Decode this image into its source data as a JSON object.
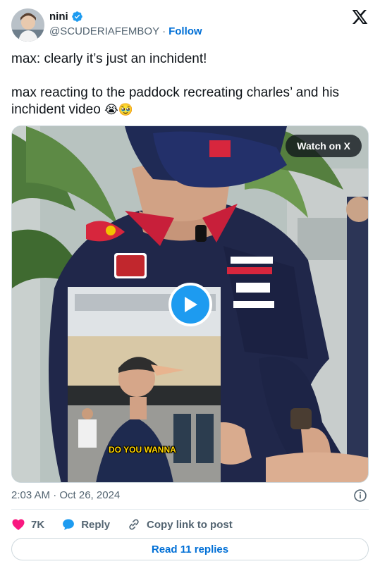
{
  "author": {
    "display_name": "nini",
    "handle": "@SCUDERIAFEMBOY",
    "separator": "·",
    "follow_label": "Follow"
  },
  "tweet": {
    "line1": "max: clearly it’s just an inchident!",
    "line2": "max reacting to the paddock recreating charles’ and his inchident video",
    "line2_emojis": "😭🥹"
  },
  "media": {
    "watch_label": "Watch on X",
    "caption": "DO YOU WANNA"
  },
  "meta": {
    "timestamp": "2:03 AM · Oct 26, 2024"
  },
  "actions": {
    "likes_count": "7K",
    "reply_label": "Reply",
    "copy_label": "Copy link to post"
  },
  "footer": {
    "read_replies_label": "Read 11 replies"
  },
  "colors": {
    "brand_blue": "#1d9bf0",
    "link_blue": "#006fd6",
    "like_pink": "#f91880",
    "secondary_text": "#536471"
  }
}
